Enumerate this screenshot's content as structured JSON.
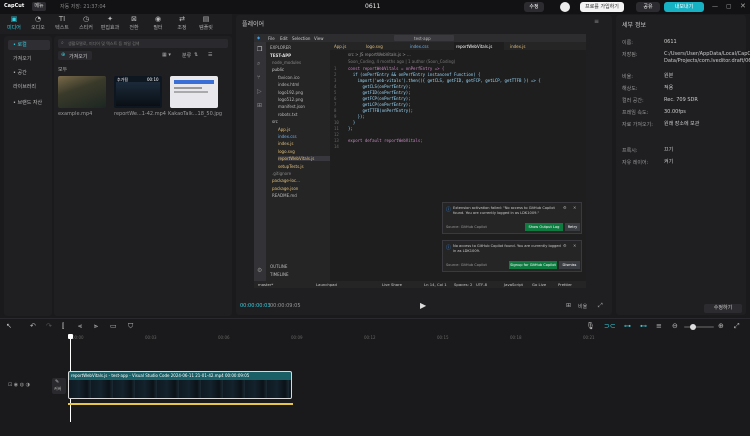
{
  "app": {
    "logo": "CapCut",
    "menu_label": "메뉴",
    "autosave": "자동 저장: 21:37:04",
    "project_title": "0611",
    "btn_share": "수정",
    "btn_pro": "프로를 가입하기",
    "btn_feedback": "공유",
    "btn_export": "내보내기"
  },
  "toolbar": {
    "items": [
      {
        "label": "미디어",
        "icon": "media-icon"
      },
      {
        "label": "오디오",
        "icon": "audio-icon"
      },
      {
        "label": "텍스트",
        "icon": "text-icon"
      },
      {
        "label": "스티커",
        "icon": "sticker-icon"
      },
      {
        "label": "편집효과",
        "icon": "effects-icon"
      },
      {
        "label": "전환",
        "icon": "transition-icon"
      },
      {
        "label": "필터",
        "icon": "filter-icon"
      },
      {
        "label": "조정",
        "icon": "adjust-icon"
      },
      {
        "label": "템플릿",
        "icon": "template-icon"
      }
    ]
  },
  "sidebar": {
    "items": [
      {
        "label": "• 로컬"
      },
      {
        "label": "가져오기"
      },
      {
        "label": "• 공간"
      },
      {
        "label": "라이브러리"
      },
      {
        "label": "• 브랜드 자산"
      }
    ]
  },
  "media": {
    "search_placeholder": "생활모델로, 미디어 및 텍스트 등 파일 검색",
    "import_label": "가져오기",
    "sort_label": "분류",
    "all_label": "모두",
    "items": [
      {
        "name": "example.mp4",
        "badge": ""
      },
      {
        "name": "reportWe...1-42.mp4",
        "badge": "추가됨",
        "duration": "00:10"
      },
      {
        "name": "KakaoTalk...18_50.jpg",
        "badge": ""
      }
    ]
  },
  "player": {
    "title": "플레이어",
    "time_current": "00:00:00:03",
    "time_total": "00:00:09:05",
    "ratio_label": "비율"
  },
  "vscode": {
    "menu": [
      "File",
      "Edit",
      "Selection",
      "View"
    ],
    "search": "test-app",
    "tabs": [
      "App.js",
      "logo.svg",
      "index.css",
      "reportWebVitals.js",
      "index.js"
    ],
    "explorer_title": "EXPLORER",
    "project": "TEST-APP",
    "files": [
      "node_modules",
      "public",
      "favicon.ico",
      "index.html",
      "logo192.png",
      "logo512.png",
      "manifest.json",
      "robots.txt",
      "src",
      "App.js",
      "index.css",
      "index.js",
      "logo.svg",
      "reportWebVitals.js",
      "setupTests.js",
      ".gitignore",
      "package-loc...",
      "package.json",
      "README.md"
    ],
    "outline": "OUTLINE",
    "timeline_panel": "TIMELINE",
    "breadcrumb": "src > JS reportWebVitals.js > ...",
    "blame": "Soon_Coding, 4 months ago | 1 author (Soon_Coding)",
    "code_lines": [
      "const reportWebVitals = onPerfEntry => {",
      "  if (onPerfEntry && onPerfEntry instanceof Function) {",
      "    import('web-vitals').then(({ getCLS, getFID, getFCP, getLCP, getTTFB }) => {",
      "      getCLS(onPerfEntry);",
      "      getFID(onPerfEntry);",
      "      getFCP(onPerfEntry);",
      "      getLCP(onPerfEntry);",
      "      getTTFB(onPerfEntry);",
      "    });",
      "  }",
      "};",
      "",
      "export default reportWebVitals;",
      ""
    ],
    "notif1": {
      "text": "Extension activation failed: \"No access to GitHub Copilot found. You are currently logged in as LDK1009.\"",
      "source": "Source: GitHub Copilot",
      "btn1": "Show Output Log",
      "btn2": "Retry"
    },
    "notif2": {
      "text": "No access to GitHub Copilot found. You are currently logged in as LDK1009.",
      "source": "Source: GitHub Copilot",
      "btn1": "Signup for GitHub Copilot",
      "btn2": "Dismiss"
    },
    "status_left": "master*",
    "status_mid": "Launchpad",
    "status_live": "Live Share",
    "status_pos": "Ln 14, Col 1",
    "status_spaces": "Spaces: 2",
    "status_enc": "UTF-8",
    "status_lang": "JavaScript",
    "status_golive": "Go Live",
    "status_prettier": "Prettier"
  },
  "props": {
    "title": "세부 정보",
    "rows": [
      {
        "label": "이름:",
        "value": "0611"
      },
      {
        "label": "저장됨:",
        "value": "C:/Users/User/AppData/Local/CapCut/User Data/Projects/com.lveditor.draft/0611"
      },
      {
        "label": "비율:",
        "value": "원본"
      },
      {
        "label": "해상도:",
        "value": "적용"
      },
      {
        "label": "컬러 공간:",
        "value": "Rec. 709 SDR"
      },
      {
        "label": "프레임 속도:",
        "value": "30.00fps"
      },
      {
        "label": "자료 가져오기:",
        "value": "원래 장소에 보관"
      },
      {
        "label": "프록시:",
        "value": "끄기"
      },
      {
        "label": "자유 레이어:",
        "value": "켜기"
      }
    ],
    "btn_edit": "수정하기"
  },
  "timeline": {
    "ticks": [
      "00:00",
      "00:03",
      "00:06",
      "00:09",
      "00:12",
      "00:15",
      "00:18",
      "00:21"
    ],
    "clip_label": "reportWebVitals.js - test-app - Visual Studio Code 2024-06-11 21-01-42.mp4  00:00:09:05",
    "cover_label": "커버"
  }
}
